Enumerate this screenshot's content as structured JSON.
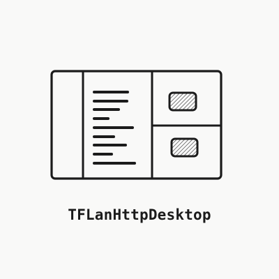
{
  "caption": "TFLanHttpDesktop",
  "icon": {
    "name": "desktop-window-icon",
    "stroke_color": "#1b1b1b",
    "hatch_color": "#777777",
    "background_color": "#f9f9f8"
  }
}
